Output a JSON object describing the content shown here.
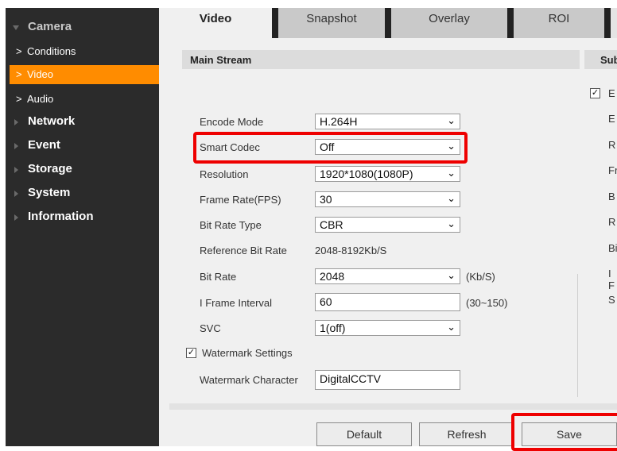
{
  "sidebar": {
    "camera": "Camera",
    "items_sub": [
      "Conditions",
      "Video",
      "Audio"
    ],
    "items": [
      "Network",
      "Event",
      "Storage",
      "System",
      "Information"
    ],
    "chevron": ">"
  },
  "tabs": [
    "Video",
    "Snapshot",
    "Overlay",
    "ROI"
  ],
  "main": {
    "header": "Main Stream",
    "rows": {
      "encode_mode": {
        "label": "Encode Mode",
        "value": "H.264H"
      },
      "smart_codec": {
        "label": "Smart Codec",
        "value": "Off"
      },
      "resolution": {
        "label": "Resolution",
        "value": "1920*1080(1080P)"
      },
      "frame_rate": {
        "label": "Frame Rate(FPS)",
        "value": "30"
      },
      "bit_rate_type": {
        "label": "Bit Rate Type",
        "value": "CBR"
      },
      "ref_bit_rate": {
        "label": "Reference Bit Rate",
        "value": "2048-8192Kb/S"
      },
      "bit_rate": {
        "label": "Bit Rate",
        "value": "2048",
        "unit": "(Kb/S)"
      },
      "i_frame": {
        "label": "I Frame Interval",
        "value": "60",
        "range": "(30~150)"
      },
      "svc": {
        "label": "SVC",
        "value": "1(off)"
      }
    },
    "watermark_settings": "Watermark Settings",
    "watermark_char": {
      "label": "Watermark Character",
      "value": "DigitalCCTV"
    },
    "check_mark": "✓",
    "dropdown_arrow": "⌄"
  },
  "sub": {
    "header": "Sub",
    "letters": [
      "E",
      "E",
      "R",
      "Fr",
      "B",
      "R",
      "Bi",
      "I F",
      "S"
    ]
  },
  "buttons": {
    "default": "Default",
    "refresh": "Refresh",
    "save": "Save"
  },
  "colors": {
    "active": "#ff8c00",
    "highlight": "#ee0000",
    "sidebar": "#2b2b2b"
  }
}
